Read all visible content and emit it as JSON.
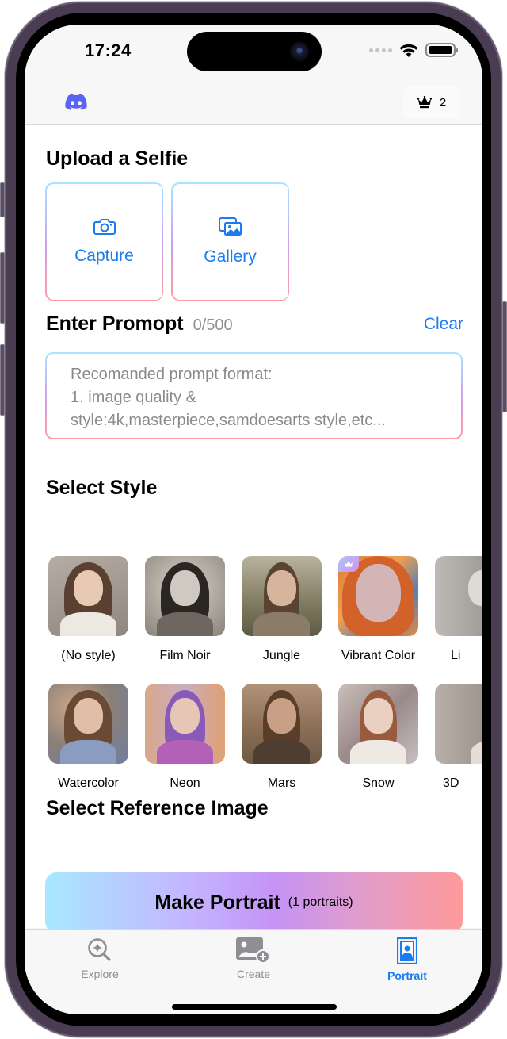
{
  "status_bar": {
    "time": "17:24",
    "icons": [
      "signal-dots-icon",
      "wifi-icon",
      "battery-icon"
    ]
  },
  "nav": {
    "left_icon": "discord-icon",
    "credits_icon": "crown-icon",
    "credits_count": "2"
  },
  "upload": {
    "title": "Upload a Selfie",
    "capture_label": "Capture",
    "capture_icon": "camera-icon",
    "gallery_label": "Gallery",
    "gallery_icon": "photo-gallery-icon"
  },
  "prompt": {
    "title": "Enter Promopt",
    "count": "0/500",
    "clear_label": "Clear",
    "value": "",
    "placeholder": "Recomanded prompt format:\n1. image quality &\nstyle:4k,masterpiece,samdoesarts style,etc..."
  },
  "styles": {
    "title": "Select Style",
    "row1": [
      {
        "label": "(No style)",
        "premium": false
      },
      {
        "label": "Film Noir",
        "premium": false
      },
      {
        "label": "Jungle",
        "premium": false
      },
      {
        "label": "Vibrant Color",
        "premium": true
      },
      {
        "label": "Li",
        "premium": false
      }
    ],
    "row2": [
      {
        "label": "Watercolor",
        "premium": false
      },
      {
        "label": "Neon",
        "premium": false
      },
      {
        "label": "Mars",
        "premium": false
      },
      {
        "label": "Snow",
        "premium": false
      },
      {
        "label": "3D",
        "premium": false
      }
    ]
  },
  "reference": {
    "title": "Select Reference Image"
  },
  "make_button": {
    "label": "Make Portrait",
    "sub_label": "(1 portraits)"
  },
  "tabs": [
    {
      "label": "Explore",
      "icon": "explore-sparkle-search-icon",
      "active": false
    },
    {
      "label": "Create",
      "icon": "add-photo-icon",
      "active": false
    },
    {
      "label": "Portrait",
      "icon": "portrait-icon",
      "active": true
    }
  ],
  "colors": {
    "accent": "#1a7cf0",
    "discord": "#5865f2",
    "inactive": "#8e8e93",
    "gradient": [
      "#a8e8ff",
      "#c593f6",
      "#ff9a9a"
    ]
  }
}
